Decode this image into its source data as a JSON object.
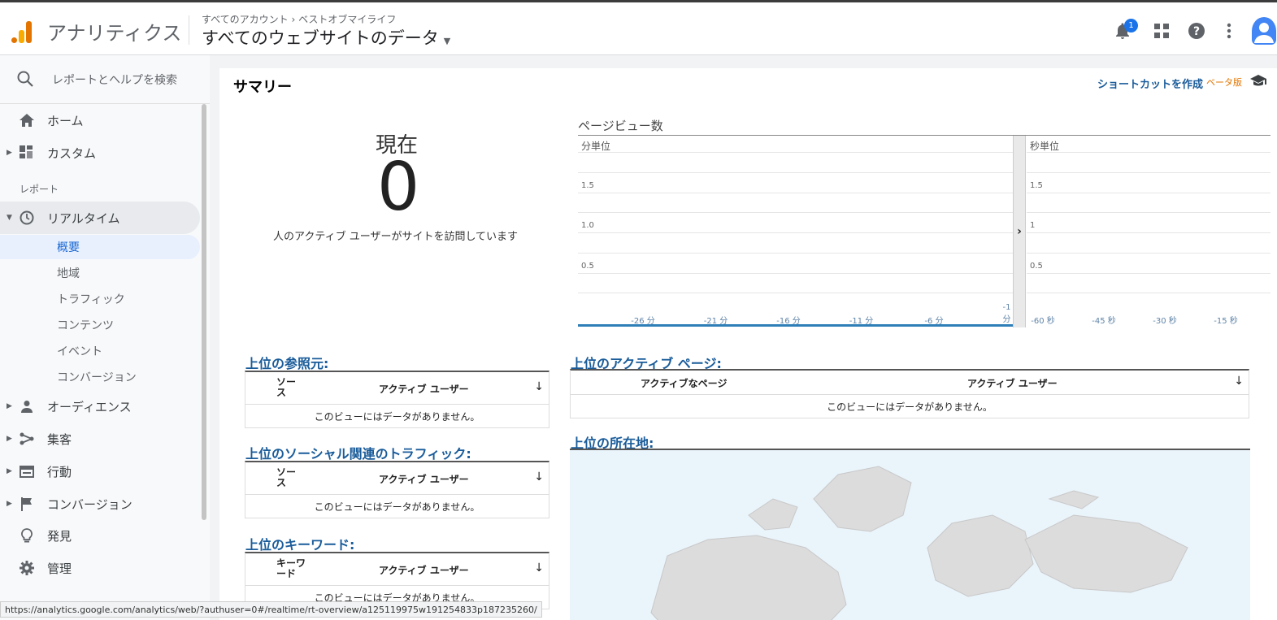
{
  "header": {
    "app_name": "アナリティクス",
    "breadcrumb": "すべてのアカウント › ベストオブマイライフ",
    "view_title": "すべてのウェブサイトのデータ",
    "notification_count": "1"
  },
  "sidebar": {
    "search_placeholder": "レポートとヘルプを検索",
    "items": [
      {
        "label": "ホーム"
      },
      {
        "label": "カスタム"
      }
    ],
    "section_label": "レポート",
    "realtime": {
      "label": "リアルタイム",
      "sub_items": [
        "概要",
        "地域",
        "トラフィック",
        "コンテンツ",
        "イベント",
        "コンバージョン"
      ]
    },
    "bottom_items": [
      {
        "label": "オーディエンス"
      },
      {
        "label": "集客"
      },
      {
        "label": "行動"
      },
      {
        "label": "コンバージョン"
      },
      {
        "label": "発見"
      },
      {
        "label": "管理"
      }
    ]
  },
  "main": {
    "title": "サマリー",
    "shortcut_label": "ショートカットを作成",
    "beta_label": "ベータ版",
    "now": {
      "label": "現在",
      "value": "0",
      "description": "人のアクティブ ユーザーがサイトを訪問しています"
    },
    "pageviews": {
      "title": "ページビュー数",
      "minutes_label": "分単位",
      "seconds_label": "秒単位"
    },
    "top_referrals": {
      "title": "上位の参照元:",
      "col1": "ソース",
      "col2": "アクティブ ユーザー",
      "empty": "このビューにはデータがありません。"
    },
    "top_social": {
      "title": "上位のソーシャル関連のトラフィック:",
      "col1": "ソース",
      "col2": "アクティブ ユーザー",
      "empty": "このビューにはデータがありません。"
    },
    "top_keywords": {
      "title": "上位のキーワード:",
      "col1": "キーワード",
      "col2": "アクティブ ユーザー",
      "empty": "このビューにはデータがありません。"
    },
    "top_active_pages": {
      "title": "上位のアクティブ ページ:",
      "col1": "アクティブなページ",
      "col2": "アクティブ ユーザー",
      "empty": "このビューにはデータがありません。"
    },
    "top_locations": {
      "title": "上位の所在地:"
    }
  },
  "chart_data": [
    {
      "type": "line",
      "title": "分単位",
      "x": [
        "-26 分",
        "-21 分",
        "-16 分",
        "-11 分",
        "-6 分",
        "-1 分"
      ],
      "y_ticks": [
        "0.5",
        "1.0",
        "1.5"
      ],
      "series": [
        {
          "values": [
            0,
            0,
            0,
            0,
            0,
            0
          ]
        }
      ],
      "ylim": [
        0,
        2
      ]
    },
    {
      "type": "line",
      "title": "秒単位",
      "x": [
        "-60 秒",
        "-45 秒",
        "-30 秒",
        "-15 秒"
      ],
      "y_ticks": [
        "0.5",
        "1",
        "1.5"
      ],
      "series": [
        {
          "values": [
            0,
            0,
            0,
            0
          ]
        }
      ],
      "ylim": [
        0,
        2
      ]
    }
  ],
  "statusbar": {
    "url": "https://analytics.google.com/analytics/web/?authuser=0#/realtime/rt-overview/a125119975w191254833p187235260/"
  },
  "colors": {
    "accent_blue": "#1a5c9a",
    "logo_orange": "#f9ab00",
    "logo_dark": "#e37400"
  }
}
